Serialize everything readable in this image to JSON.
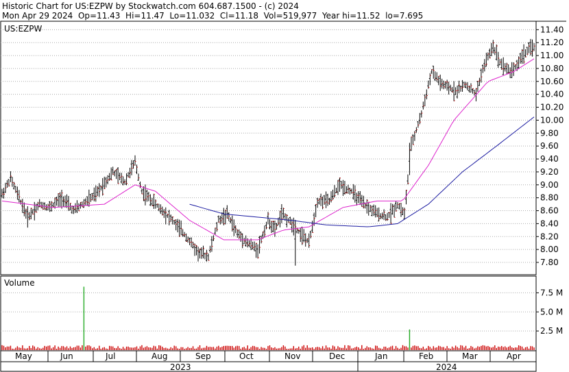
{
  "header": {
    "line1": "Historic Chart for US:EZPW by Stockwatch.com 604.687.1500 - (c) 2024",
    "line2": "Mon Apr 29 2024  Op=11.43  Hi=11.47  Lo=11.032  Cl=11.18  Vol=519,977  Year hi=11.52  lo=7.695"
  },
  "colors": {
    "price_bar": "#000000",
    "volume_bar": "#cc0000",
    "volume_spike": "#22aa22",
    "ma_short": "#dd22cc",
    "ma_long": "#1a1aa0",
    "grid": "#aaaaaa"
  },
  "chart_data": [
    {
      "type": "ohlc",
      "title": "US:EZPW",
      "ylim": [
        7.62,
        11.52
      ],
      "yticks": [
        "7.80",
        "8.00",
        "8.20",
        "8.40",
        "8.60",
        "8.80",
        "9.00",
        "9.20",
        "9.40",
        "9.60",
        "9.80",
        "10.00",
        "10.20",
        "10.40",
        "10.60",
        "10.80",
        "11.00",
        "11.20",
        "11.40"
      ],
      "grid": true,
      "keypoints": [
        [
          0,
          8.85
        ],
        [
          5,
          9.1
        ],
        [
          15,
          8.5
        ],
        [
          22,
          8.7
        ],
        [
          28,
          8.65
        ],
        [
          35,
          8.8
        ],
        [
          42,
          8.6
        ],
        [
          55,
          8.85
        ],
        [
          65,
          9.2
        ],
        [
          72,
          9.05
        ],
        [
          78,
          9.35
        ],
        [
          82,
          8.9
        ],
        [
          90,
          8.7
        ],
        [
          100,
          8.45
        ],
        [
          108,
          8.2
        ],
        [
          115,
          7.95
        ],
        [
          121,
          7.9
        ],
        [
          127,
          8.45
        ],
        [
          132,
          8.55
        ],
        [
          138,
          8.25
        ],
        [
          144,
          8.1
        ],
        [
          150,
          8.0
        ],
        [
          156,
          8.45
        ],
        [
          160,
          8.3
        ],
        [
          164,
          8.55
        ],
        [
          170,
          8.4
        ],
        [
          175,
          8.25
        ],
        [
          180,
          8.1
        ],
        [
          185,
          8.75
        ],
        [
          192,
          8.75
        ],
        [
          198,
          9.0
        ],
        [
          205,
          8.9
        ],
        [
          212,
          8.7
        ],
        [
          220,
          8.55
        ],
        [
          226,
          8.5
        ],
        [
          232,
          8.7
        ],
        [
          236,
          8.55
        ],
        [
          240,
          9.6
        ],
        [
          246,
          10.1
        ],
        [
          252,
          10.75
        ],
        [
          258,
          10.55
        ],
        [
          266,
          10.45
        ],
        [
          272,
          10.55
        ],
        [
          278,
          10.4
        ],
        [
          282,
          10.8
        ],
        [
          288,
          11.15
        ],
        [
          292,
          10.9
        ],
        [
          298,
          10.75
        ],
        [
          302,
          10.85
        ],
        [
          305,
          11.0
        ],
        [
          312,
          11.15
        ]
      ],
      "ma_short": [
        [
          0,
          8.75
        ],
        [
          30,
          8.65
        ],
        [
          60,
          8.7
        ],
        [
          78,
          9.0
        ],
        [
          90,
          8.9
        ],
        [
          110,
          8.45
        ],
        [
          130,
          8.15
        ],
        [
          150,
          8.15
        ],
        [
          165,
          8.3
        ],
        [
          180,
          8.35
        ],
        [
          200,
          8.65
        ],
        [
          220,
          8.75
        ],
        [
          235,
          8.75
        ],
        [
          250,
          9.3
        ],
        [
          265,
          10.0
        ],
        [
          285,
          10.6
        ],
        [
          300,
          10.75
        ],
        [
          312,
          10.95
        ]
      ],
      "ma_long": [
        [
          110,
          8.7
        ],
        [
          130,
          8.55
        ],
        [
          150,
          8.5
        ],
        [
          170,
          8.45
        ],
        [
          190,
          8.38
        ],
        [
          215,
          8.35
        ],
        [
          232,
          8.4
        ],
        [
          250,
          8.7
        ],
        [
          270,
          9.2
        ],
        [
          290,
          9.6
        ],
        [
          312,
          10.05
        ]
      ]
    },
    {
      "type": "bar",
      "title": "Volume",
      "ylim": [
        0,
        9.6
      ],
      "yticks": [
        "2.5 M",
        "5.0 M",
        "7.5 M"
      ],
      "typical_volume_m": 0.5,
      "spikes": [
        {
          "day": 48,
          "value_m": 8.3
        },
        {
          "day": 239,
          "value_m": 2.7
        }
      ],
      "x_months": [
        "May",
        "Jun",
        "Jul",
        "Aug",
        "Sep",
        "Oct",
        "Nov",
        "Dec",
        "Jan",
        "Feb",
        "Mar",
        "Apr"
      ],
      "x_years": [
        "2023",
        "2024"
      ]
    }
  ]
}
